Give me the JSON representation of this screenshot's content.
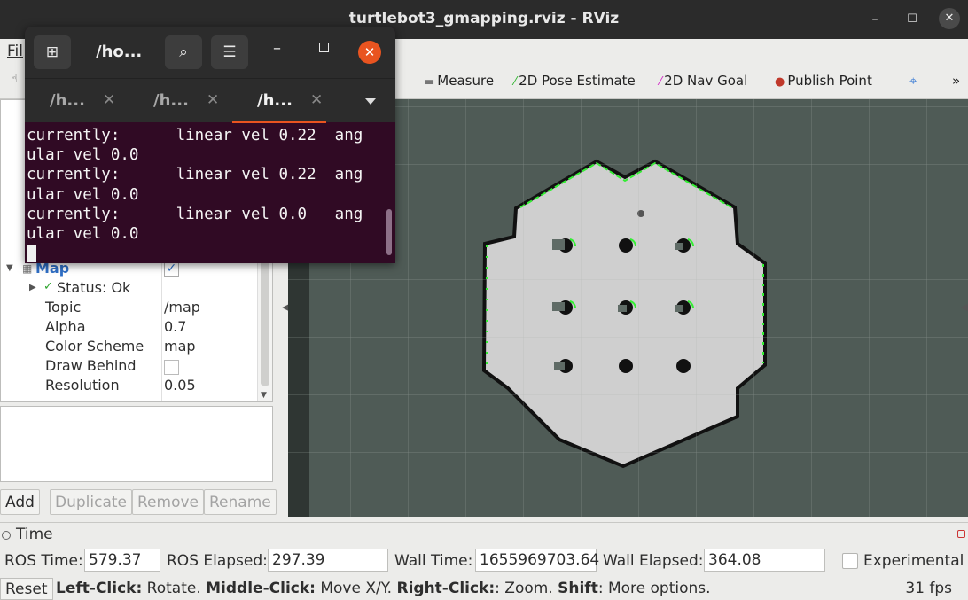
{
  "window": {
    "title": "turtlebot3_gmapping.rviz - RViz"
  },
  "menu": {
    "file": "Fil"
  },
  "toolbar": {
    "tools": [
      {
        "label": "Measure",
        "icon": "measure-icon"
      },
      {
        "label": "2D Pose Estimate",
        "icon": "green-arrow-icon"
      },
      {
        "label": "2D Nav Goal",
        "icon": "magenta-arrow-icon"
      },
      {
        "label": "Publish Point",
        "icon": "map-pin-icon"
      }
    ],
    "more": "»"
  },
  "displays": {
    "map": {
      "name": "Map",
      "checked": true,
      "status": "Status: Ok",
      "props": [
        {
          "name": "Topic",
          "value": "/map"
        },
        {
          "name": "Alpha",
          "value": "0.7"
        },
        {
          "name": "Color Scheme",
          "value": "map"
        },
        {
          "name": "Draw Behind",
          "value": ""
        },
        {
          "name": "Resolution",
          "value": "0.05"
        }
      ]
    },
    "buttons": {
      "add": "Add",
      "duplicate": "Duplicate",
      "remove": "Remove",
      "rename": "Rename"
    }
  },
  "time": {
    "header": "Time",
    "ros_time_label": "ROS Time:",
    "ros_time": "579.37",
    "ros_elapsed_label": "ROS Elapsed:",
    "ros_elapsed": "297.39",
    "wall_time_label": "Wall Time:",
    "wall_time": "1655969703.64",
    "wall_elapsed_label": "Wall Elapsed:",
    "wall_elapsed": "364.08",
    "experimental": "Experimental"
  },
  "status": {
    "reset": "Reset",
    "hint_left_b": "Left-Click:",
    "hint_left": " Rotate. ",
    "hint_mid_b": "Middle-Click:",
    "hint_mid": " Move X/Y. ",
    "hint_right_b": "Right-Click:",
    "hint_right": ": Zoom. ",
    "hint_shift_b": "Shift",
    "hint_shift": ": More options.",
    "fps": "31 fps"
  },
  "terminal": {
    "title": "/ho...",
    "tabs": [
      {
        "label": "/h...",
        "active": false
      },
      {
        "label": "/h...",
        "active": false
      },
      {
        "label": "/h...",
        "active": true
      }
    ],
    "lines": [
      "currently:      linear vel 0.22  ang",
      "ular vel 0.0",
      "currently:      linear vel 0.22  ang",
      "ular vel 0.0",
      "currently:      linear vel 0.0   ang",
      "ular vel 0.0"
    ]
  },
  "colors": {
    "terminal_bg": "#300a24",
    "ubuntu_orange": "#e95420",
    "map_free": "#cfcfcf",
    "map_unknown": "#4f5b56",
    "scan_green": "#33ee33",
    "view_grid": "#a9b0ad"
  }
}
